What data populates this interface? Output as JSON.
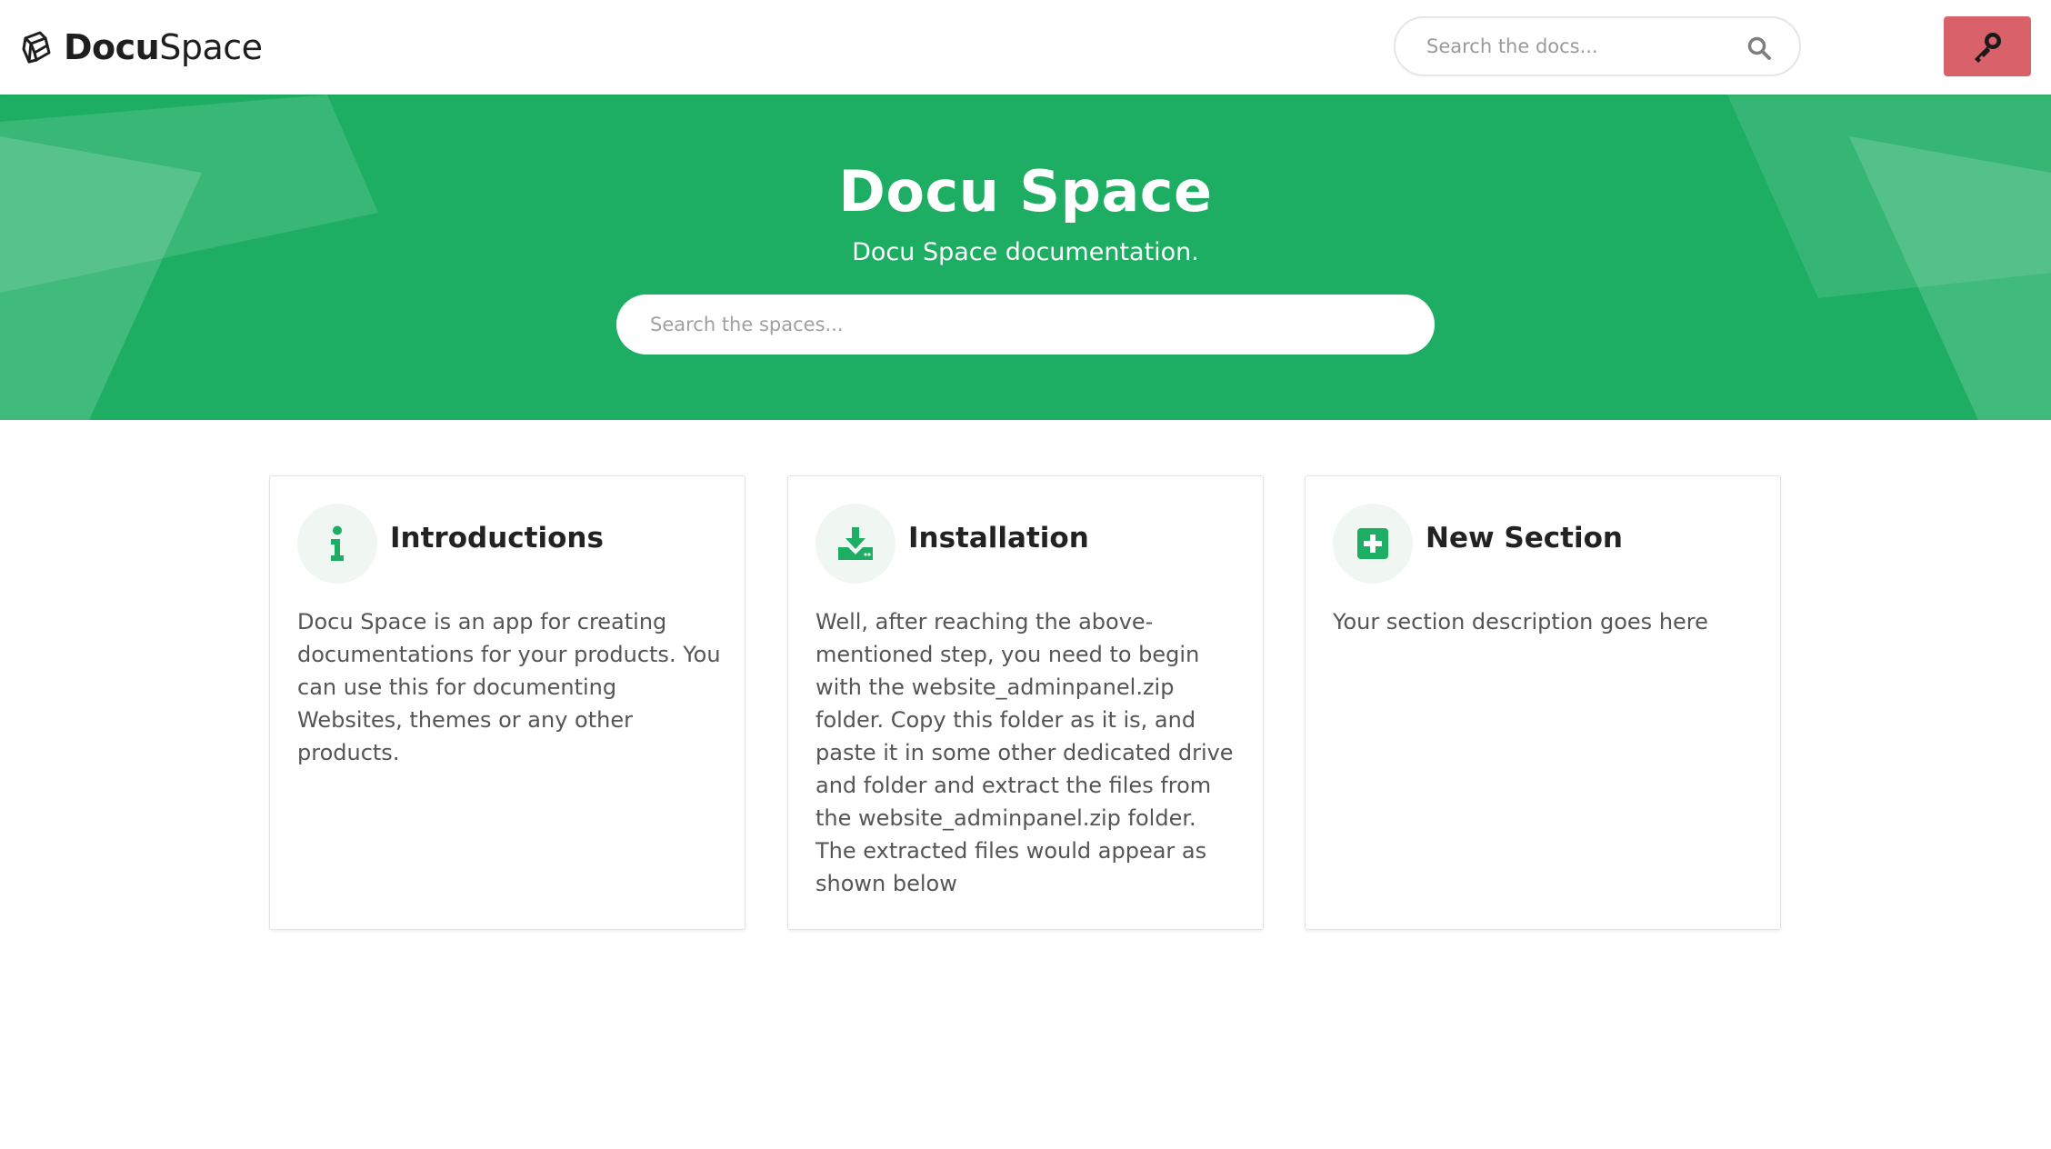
{
  "header": {
    "brand_bold": "Docu",
    "brand_light": "Space",
    "search_placeholder": "Search the docs..."
  },
  "hero": {
    "title": "Docu Space",
    "subtitle": "Docu Space documentation.",
    "search_placeholder": "Search the spaces..."
  },
  "sections": [
    {
      "icon": "info-icon",
      "title": "Introductions",
      "description": "Docu Space is an app for creating documentations for your products. You can use this for documenting Websites, themes or any other products."
    },
    {
      "icon": "download-icon",
      "title": "Installation",
      "description": "Well, after reaching the above-mentioned step, you need to begin with the website_adminpanel.zip folder. Copy this folder as it is, and paste it in some other dedicated drive and folder and extract the files from the website_adminpanel.zip folder. The extracted files would appear as shown below"
    },
    {
      "icon": "plus-square-icon",
      "title": "New Section",
      "description": "Your section description goes here"
    }
  ],
  "colors": {
    "accent_green": "#1dae63",
    "login_button": "#d9626a",
    "icon_bg": "#f0f7f2"
  }
}
